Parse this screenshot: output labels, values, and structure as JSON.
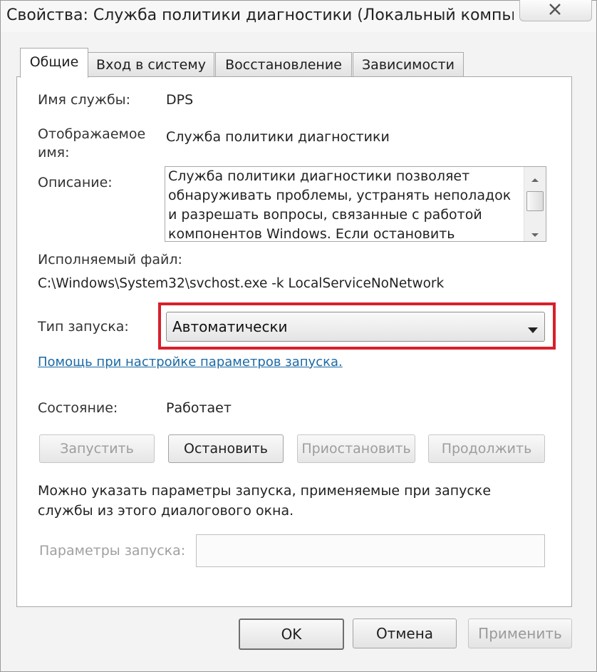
{
  "window": {
    "title": "Свойства: Служба политики диагностики (Локальный компьют..."
  },
  "tabs": [
    {
      "label": "Общие",
      "active": true
    },
    {
      "label": "Вход в систему",
      "active": false
    },
    {
      "label": "Восстановление",
      "active": false
    },
    {
      "label": "Зависимости",
      "active": false
    }
  ],
  "general": {
    "service_name_label": "Имя службы:",
    "service_name_value": "DPS",
    "display_name_label_line1": "Отображаемое",
    "display_name_label_line2": "имя:",
    "display_name_value": "Служба политики диагностики",
    "description_label": "Описание:",
    "description_lines": [
      "Служба политики диагностики позволяет",
      "обнаруживать проблемы, устранять неполадок",
      "и разрешать вопросы, связанные с работой",
      "компонентов Windows.  Если остановить"
    ],
    "executable_label": "Исполняемый файл:",
    "executable_value": "C:\\Windows\\System32\\svchost.exe -k LocalServiceNoNetwork",
    "startup_type_label": "Тип запуска:",
    "startup_type_value": "Автоматически",
    "help_link": "Помощь при настройке параметров запуска.",
    "status_label": "Состояние:",
    "status_value": "Работает",
    "buttons": {
      "start": "Запустить",
      "stop": "Остановить",
      "pause": "Приостановить",
      "resume": "Продолжить"
    },
    "hint_line1": "Можно указать параметры запуска, применяемые при запуске",
    "hint_line2": "службы из этого диалогового окна.",
    "start_params_label": "Параметры запуска:",
    "start_params_value": ""
  },
  "footer": {
    "ok": "OK",
    "cancel": "Отмена",
    "apply": "Применить"
  },
  "colors": {
    "highlight": "#d8202a",
    "link": "#1b6aa5"
  }
}
